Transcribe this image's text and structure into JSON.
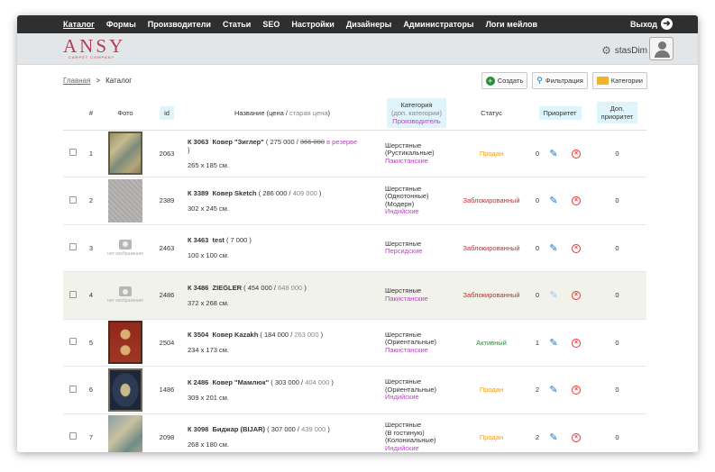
{
  "nav": {
    "items": [
      "Каталог",
      "Формы",
      "Производители",
      "Статьи",
      "SEO",
      "Настройки",
      "Дизайнеры",
      "Администраторы",
      "Логи мейлов"
    ],
    "logout": "Выход"
  },
  "header": {
    "logo": "ANSY",
    "logo_sub": "CARPET COMPANY",
    "username": "stasDim"
  },
  "breadcrumb": {
    "home": "Главная",
    "sep": ">",
    "current": "Каталог"
  },
  "actions": {
    "create": "Создать",
    "filter": "Фильтрация",
    "categories": "Категории"
  },
  "table": {
    "headers": {
      "num": "#",
      "photo": "Фото",
      "id": "id",
      "name_main": "Название (цена / ",
      "name_old": "старая цена",
      "name_close": ")",
      "cat1": "Категория",
      "cat2": "(доп. категории)",
      "cat3": "Производитель",
      "status": "Статус",
      "priority": "Приоритет",
      "extra1": "Доп.",
      "extra2": "приоритет"
    },
    "no_image": "нет изображения",
    "rows": [
      {
        "num": "1",
        "id": "2063",
        "code": "К 3063",
        "title": "Ковер \"Зиглер\"",
        "price": "275 000",
        "old": "366 000",
        "reserve": "в резерве",
        "size": "265 x 185 см.",
        "cat": [
          "Шерстяные",
          "(Рустикальные)"
        ],
        "mfr": "Пакистанские",
        "status": "Продан",
        "priority": "0",
        "extra": "0"
      },
      {
        "num": "2",
        "id": "2389",
        "code": "К 3389",
        "title": "Ковер Sketch",
        "price": "286 000",
        "old": "409 000",
        "size": "302 x 245 см.",
        "cat": [
          "Шерстяные",
          "(Однотонные)",
          "(Модерн)"
        ],
        "mfr": "Индийские",
        "status": "Заблокированный",
        "priority": "0",
        "extra": "0"
      },
      {
        "num": "3",
        "id": "2463",
        "code": "К 3463",
        "title": "test",
        "price": "7 000",
        "size": "100 x 100 см.",
        "cat": [
          "Шерстяные"
        ],
        "mfr": "Персидские",
        "status": "Заблокированный",
        "priority": "0",
        "extra": "0"
      },
      {
        "num": "4",
        "id": "2486",
        "code": "К 3486",
        "title": "ZIEGLER",
        "price": "454 000",
        "old": "648 000",
        "size": "372 x 268 см.",
        "cat": [
          "Шерстяные"
        ],
        "mfr": "Пакистанские",
        "status": "Заблокированный",
        "priority": "0",
        "extra": "0"
      },
      {
        "num": "5",
        "id": "2504",
        "code": "К 3504",
        "title": "Ковер Kazakh",
        "price": "184 000",
        "old": "263 000",
        "size": "234 x 173 см.",
        "cat": [
          "Шерстяные",
          "(Ориентальные)"
        ],
        "mfr": "Пакистанские",
        "status": "Активный",
        "priority": "1",
        "extra": "0"
      },
      {
        "num": "6",
        "id": "1486",
        "code": "К 2486",
        "title": "Ковер \"Мамлюк\"",
        "price": "303 000",
        "old": "404 000",
        "size": "309 x 201 см.",
        "cat": [
          "Шерстяные",
          "(Ориентальные)"
        ],
        "mfr": "Индийские",
        "status": "Продан",
        "priority": "2",
        "extra": "0"
      },
      {
        "num": "7",
        "id": "2098",
        "code": "К 3098",
        "title": "Биджар (BIJAR)",
        "price": "307 000",
        "old": "439 000",
        "size": "268 x 180 см.",
        "cat": [
          "Шерстяные",
          "(В гостиную)",
          "(Колониальные)"
        ],
        "mfr": "Индийские",
        "status": "Продан",
        "priority": "2",
        "extra": "0"
      }
    ]
  }
}
